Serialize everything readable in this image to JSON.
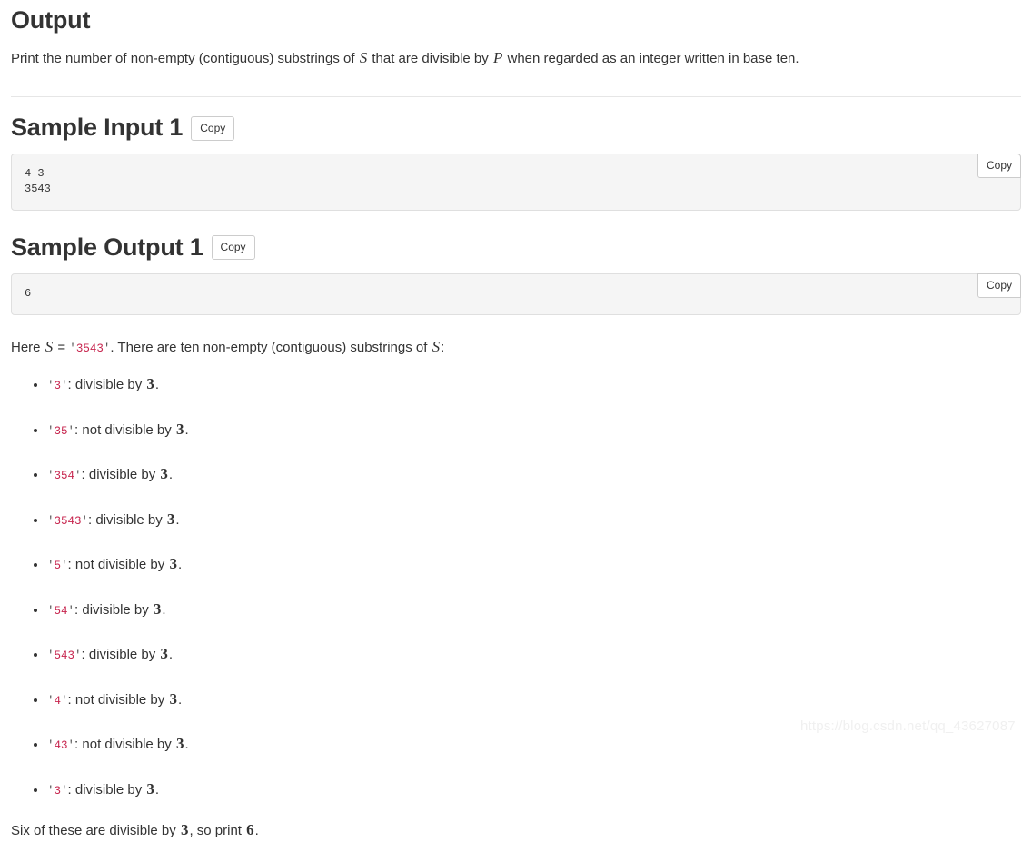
{
  "output_section": {
    "title": "Output",
    "description_parts": [
      {
        "type": "text",
        "value": "Print the number of non-empty (contiguous) substrings of "
      },
      {
        "type": "mathvar",
        "value": "S"
      },
      {
        "type": "text",
        "value": " that are divisible by "
      },
      {
        "type": "mathvar",
        "value": "P"
      },
      {
        "type": "text",
        "value": " when regarded as an integer written in base ten."
      }
    ],
    "description_plain": "Print the number of non-empty (contiguous) substrings of S that are divisible by P when regarded as an integer written in base ten."
  },
  "sample_input": {
    "title": "Sample Input 1",
    "copy_label": "Copy",
    "code_copy_label": "Copy",
    "code": "4 3\n3543"
  },
  "sample_output": {
    "title": "Sample Output 1",
    "copy_label": "Copy",
    "code_copy_label": "Copy",
    "code": "6"
  },
  "explanation": {
    "intro_prefix": "Here ",
    "intro_var": "S",
    "intro_eq": " = ",
    "intro_quote_open": "'",
    "intro_code": "3543",
    "intro_quote_close": "'",
    "intro_middle": ". There are ten non-empty (contiguous) substrings of ",
    "intro_var2": "S",
    "intro_suffix": ":",
    "intro_plain": "Here S = '3543'. There are ten non-empty (contiguous) substrings of S:",
    "items": [
      {
        "code": "3",
        "verdict": ": divisible by ",
        "divisor": "3",
        "period": "."
      },
      {
        "code": "35",
        "verdict": ": not divisible by ",
        "divisor": "3",
        "period": "."
      },
      {
        "code": "354",
        "verdict": ": divisible by ",
        "divisor": "3",
        "period": "."
      },
      {
        "code": "3543",
        "verdict": ": divisible by ",
        "divisor": "3",
        "period": "."
      },
      {
        "code": "5",
        "verdict": ": not divisible by ",
        "divisor": "3",
        "period": "."
      },
      {
        "code": "54",
        "verdict": ": divisible by ",
        "divisor": "3",
        "period": "."
      },
      {
        "code": "543",
        "verdict": ": divisible by ",
        "divisor": "3",
        "period": "."
      },
      {
        "code": "4",
        "verdict": ": not divisible by ",
        "divisor": "3",
        "period": "."
      },
      {
        "code": "43",
        "verdict": ": not divisible by ",
        "divisor": "3",
        "period": "."
      },
      {
        "code": "3",
        "verdict": ": divisible by ",
        "divisor": "3",
        "period": "."
      }
    ],
    "closing_prefix": "Six of these are divisible by ",
    "closing_divisor": "3",
    "closing_middle": ", so print ",
    "closing_result": "6",
    "closing_suffix": ".",
    "closing_plain": "Six of these are divisible by 3, so print 6."
  },
  "watermark": {
    "text": "https://blog.csdn.net/qq_43627087"
  },
  "colors": {
    "inline_code": "#c7254e",
    "code_block_bg": "#f5f5f5",
    "code_block_border": "#dfdfdf",
    "text": "#333333",
    "divider": "#e6e6e6",
    "watermark": "#f0f0f0"
  }
}
